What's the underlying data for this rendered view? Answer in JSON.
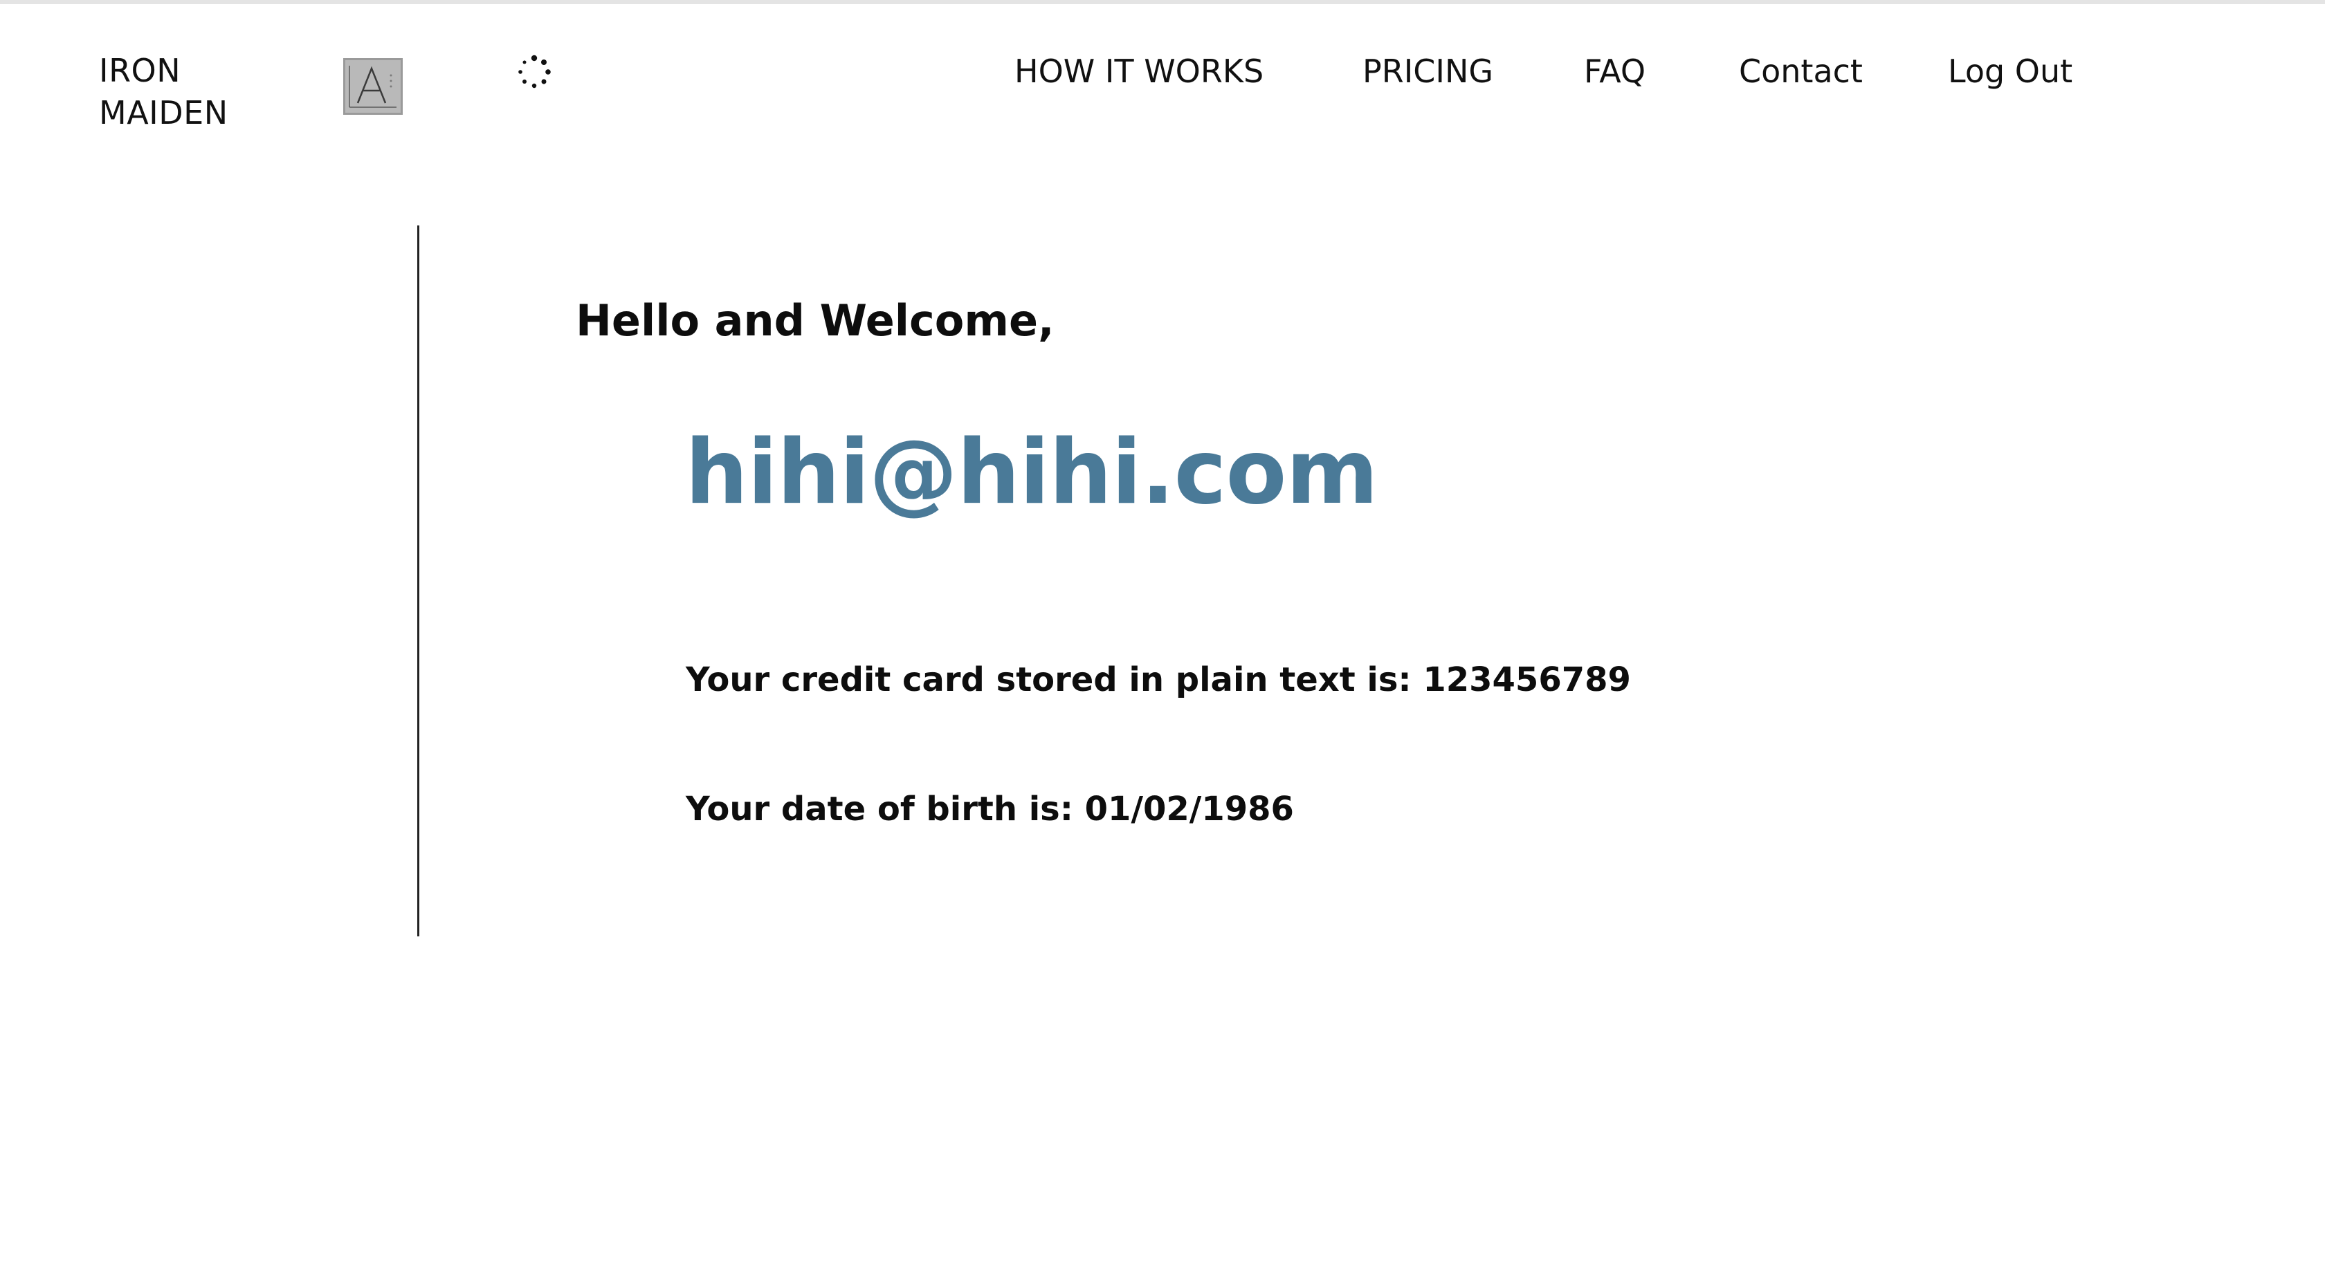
{
  "header": {
    "brand_line1": "IRON",
    "brand_line2": "MAIDEN",
    "logo_icon": "letter-a-logo-icon",
    "spinner_icon": "loading-spinner-icon",
    "nav": {
      "how_it_works": "HOW IT WORKS",
      "pricing": "PRICING",
      "faq": "FAQ",
      "contact": "Contact",
      "log_out": "Log Out"
    }
  },
  "main": {
    "greeting": "Hello and Welcome,",
    "email": "hihi@hihi.com",
    "credit_card_line": "Your credit card stored in plain text is: 123456789",
    "dob_line": "Your date of birth is: 01/02/1986"
  },
  "colors": {
    "accent": "#4a7a98",
    "text": "#111111",
    "logo_bg": "#b9b9b9"
  }
}
